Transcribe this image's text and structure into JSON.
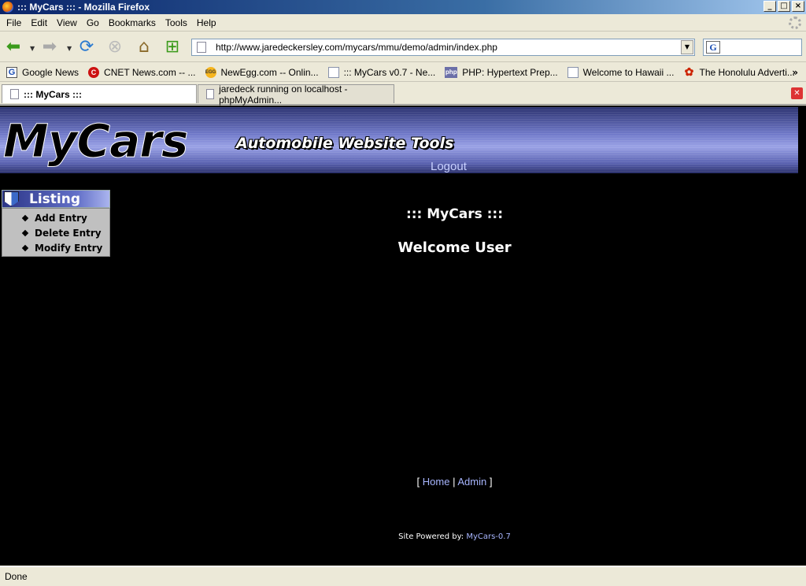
{
  "window": {
    "title": "::: MyCars ::: - Mozilla Firefox",
    "controls": [
      "_",
      "□",
      "×"
    ]
  },
  "menu": [
    "File",
    "Edit",
    "View",
    "Go",
    "Bookmarks",
    "Tools",
    "Help"
  ],
  "nav": {
    "url": "http://www.jaredeckersley.com/mycars/mmu/demo/admin/index.php"
  },
  "bookmarks": [
    {
      "label": "Google News",
      "icon": "google-icon"
    },
    {
      "label": "CNET News.com -- ...",
      "icon": "cnet-icon"
    },
    {
      "label": "NewEgg.com -- Onlin...",
      "icon": "newegg-icon"
    },
    {
      "label": "::: MyCars v0.7 - Ne...",
      "icon": "page-icon"
    },
    {
      "label": "PHP: Hypertext Prep...",
      "icon": "php-icon"
    },
    {
      "label": "Welcome to Hawaii ...",
      "icon": "page-icon"
    },
    {
      "label": "The Honolulu Adverti...",
      "icon": "hibiscus-icon"
    }
  ],
  "bookmarks_more": "»",
  "tabs": [
    {
      "label": "::: MyCars :::",
      "active": true
    },
    {
      "label": "jaredeck running on localhost - phpMyAdmin...",
      "active": false
    }
  ],
  "page": {
    "logo": "MyCars",
    "tagline": "Automobile Website Tools",
    "logout": "Logout",
    "sidebar": {
      "title": "Listing",
      "items": [
        "Add Entry",
        "Delete Entry",
        "Modify Entry"
      ]
    },
    "heading": "::: MyCars :::",
    "welcome": "Welcome User",
    "footer": {
      "open": "[",
      "home": "Home",
      "sep": "|",
      "admin": "Admin",
      "close": "]",
      "powered_prefix": "Site Powered by: ",
      "powered_link": "MyCars-0.7"
    }
  },
  "status": "Done",
  "colors": {
    "background": "#000000",
    "link": "#a8b6ff",
    "banner": "#6f78c8"
  }
}
